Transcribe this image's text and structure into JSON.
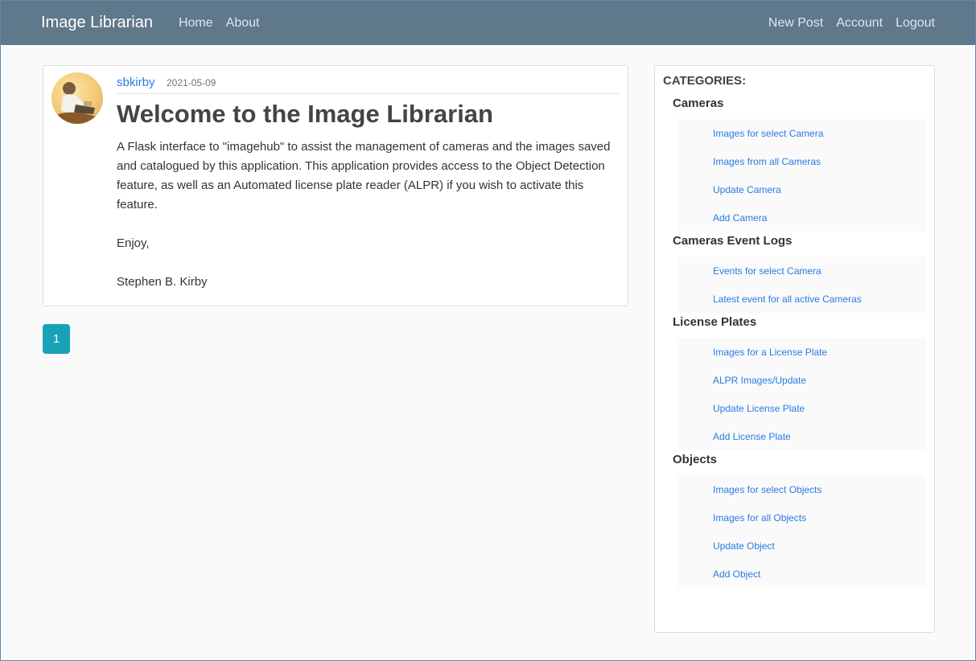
{
  "navbar": {
    "brand": "Image Librarian",
    "left_links": [
      "Home",
      "About"
    ],
    "right_links": [
      "New Post",
      "Account",
      "Logout"
    ]
  },
  "post": {
    "author": "sbkirby",
    "date": "2021-05-09",
    "title": "Welcome to the Image Librarian",
    "paragraphs": [
      "A Flask interface to \"imagehub\" to assist the management of cameras and the images saved and catalogued by this application. This application provides access to the Object Detection feature, as well as an Automated license plate reader (ALPR) if you wish to activate this feature.",
      "Enjoy,",
      "Stephen B. Kirby"
    ]
  },
  "pagination": {
    "current_page": "1"
  },
  "sidebar": {
    "heading": "CATEGORIES:",
    "groups": [
      {
        "title": "Cameras",
        "links": [
          "Images for select Camera",
          "Images from all Cameras",
          "Update Camera",
          "Add Camera"
        ]
      },
      {
        "title": "Cameras Event Logs",
        "links": [
          "Events for select Camera",
          "Latest event for all active Cameras"
        ]
      },
      {
        "title": "License Plates",
        "links": [
          "Images for a License Plate",
          "ALPR Images/Update",
          "Update License Plate",
          "Add License Plate"
        ]
      },
      {
        "title": "Objects",
        "links": [
          "Images for select Objects",
          "Images for all Objects",
          "Update Object",
          "Add Object"
        ]
      }
    ]
  },
  "colors": {
    "navbar": "#5f788a",
    "link": "#2a7ae2",
    "pager": "#17a2b8",
    "background": "#fafafa"
  }
}
